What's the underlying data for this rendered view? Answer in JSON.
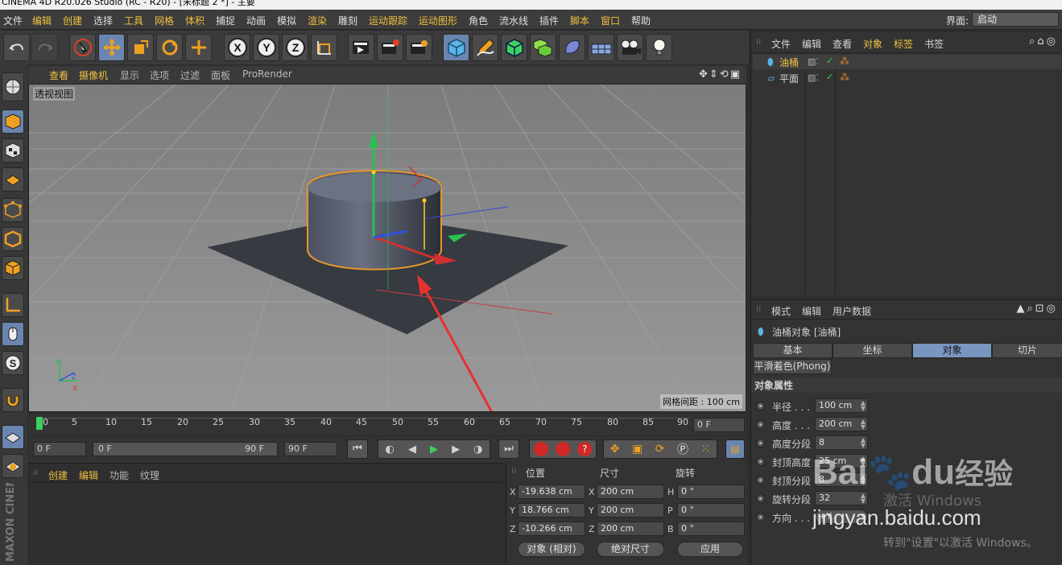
{
  "window": {
    "title": "CINEMA 4D R20.026 Studio (RC - R20) - [未标题 2 *] - 主要"
  },
  "menubar": {
    "items": [
      "文件",
      "编辑",
      "创建",
      "选择",
      "工具",
      "网格",
      "体积",
      "捕捉",
      "动画",
      "模拟",
      "渲染",
      "雕刻",
      "运动跟踪",
      "运动图形",
      "角色",
      "流水线",
      "插件",
      "脚本",
      "窗口",
      "帮助"
    ],
    "layout_label": "界面:",
    "layout_value": "启动"
  },
  "toolbar": {
    "icons": [
      "undo-icon",
      "redo-icon",
      "live-selection-icon",
      "move-icon",
      "scale-icon",
      "rotate-icon",
      "last-tool-icon",
      "x-axis-icon",
      "y-axis-icon",
      "z-axis-icon",
      "coordinate-system-icon",
      "render-view-icon",
      "render-picture-viewer-icon",
      "edit-render-settings-icon",
      "cube-icon",
      "pen-icon",
      "subdivision-icon",
      "cloner-icon",
      "deformer-icon",
      "floor-icon",
      "camera-icon",
      "light-icon"
    ],
    "axis_x": "X",
    "axis_y": "Y",
    "axis_z": "Z"
  },
  "viewport": {
    "menu": [
      "查看",
      "摄像机",
      "显示",
      "选项",
      "过滤",
      "面板",
      "ProRender"
    ],
    "label": "透视视图",
    "grid_spacing": "网格间距 : 100 cm",
    "axis_y": "Y",
    "axis_z": "Z",
    "axis_x": "X"
  },
  "timeline": {
    "ticks": [
      "0",
      "5",
      "10",
      "15",
      "20",
      "25",
      "30",
      "35",
      "40",
      "45",
      "50",
      "55",
      "60",
      "65",
      "70",
      "75",
      "80",
      "85",
      "90"
    ],
    "current_frame": "0 F"
  },
  "playbar": {
    "start_field": "0 F",
    "range_start": "0 F",
    "range_end": "90 F",
    "end_field": "90 F"
  },
  "material_panel": {
    "tabs": [
      "创建",
      "编辑",
      "功能",
      "纹理"
    ]
  },
  "coordinates": {
    "headers": [
      "位置",
      "尺寸",
      "旋转"
    ],
    "rows": [
      {
        "axis": "X",
        "pos": "-19.638 cm",
        "size_axis": "X",
        "size": "200 cm",
        "rot_axis": "H",
        "rot": "0 °"
      },
      {
        "axis": "Y",
        "pos": "18.766 cm",
        "size_axis": "Y",
        "size": "200 cm",
        "rot_axis": "P",
        "rot": "0 °"
      },
      {
        "axis": "Z",
        "pos": "-10.266 cm",
        "size_axis": "Z",
        "size": "200 cm",
        "rot_axis": "B",
        "rot": "0 °"
      }
    ],
    "mode_select": "对象 (相对)",
    "size_select": "绝对尺寸",
    "apply_button": "应用"
  },
  "object_manager": {
    "menu": [
      "文件",
      "编辑",
      "查看",
      "对象",
      "标签",
      "书签"
    ],
    "objects": [
      {
        "name": "油桶",
        "selected": true
      },
      {
        "name": "平面",
        "selected": false
      }
    ]
  },
  "attributes": {
    "menu": [
      "模式",
      "编辑",
      "用户数据"
    ],
    "object_title": "油桶对象 [油桶]",
    "tabs": [
      "基本",
      "坐标",
      "对象",
      "切片"
    ],
    "active_tab": "对象",
    "phong_tab": "平滑着色(Phong)",
    "section_title": "对象属性",
    "props": [
      {
        "label": "半径 . . .",
        "value": "100 cm"
      },
      {
        "label": "高度 . . .",
        "value": "200 cm"
      },
      {
        "label": "高度分段",
        "value": "8"
      },
      {
        "label": "封顶高度",
        "value": "25 cm"
      },
      {
        "label": "封顶分段",
        "value": "8"
      },
      {
        "label": "旋转分段",
        "value": "32"
      },
      {
        "label": "方向 . . .",
        "value": "+Y"
      }
    ]
  },
  "sidebar_brand": "MAXON CINEMA 4D",
  "watermark": {
    "site": "jingyan.baidu.com",
    "brand": "Bai",
    "brand2": "du",
    "brand3": "经验",
    "activate": "激活 Windows",
    "activate_hint": "转到\"设置\"以激活 Windows。"
  },
  "colors": {
    "accent": "#f0c040",
    "selected_tab": "#7a96c0",
    "active_tool": "#6a86b0",
    "red_arrow": "#e83030"
  }
}
